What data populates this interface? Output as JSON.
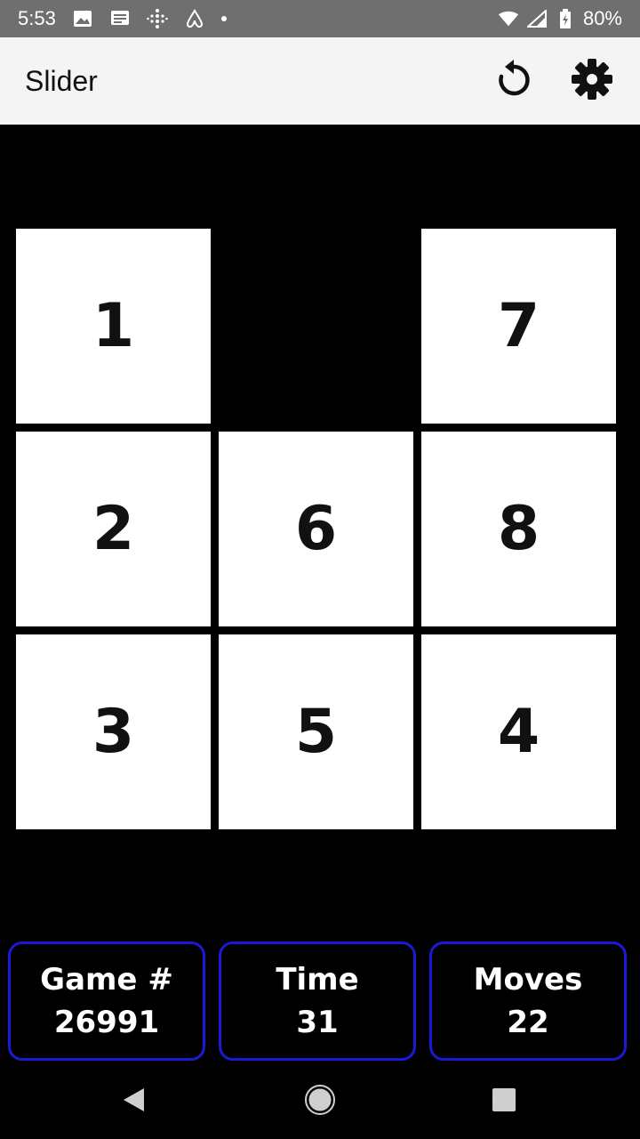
{
  "status_bar": {
    "time": "5:53",
    "battery": "80%",
    "icons": [
      "image-icon",
      "message-icon",
      "fitbit-icon",
      "airbnb-icon",
      "notification-dot",
      "wifi-icon",
      "signal-icon",
      "battery-icon"
    ]
  },
  "app_bar": {
    "title": "Slider",
    "actions": [
      "restart-icon",
      "gear-icon"
    ]
  },
  "board": {
    "rows": 3,
    "cols": 3,
    "empty": [
      0,
      1
    ],
    "tiles": [
      {
        "label": "1",
        "row": 0,
        "col": 0
      },
      {
        "label": "7",
        "row": 0,
        "col": 2
      },
      {
        "label": "2",
        "row": 1,
        "col": 0
      },
      {
        "label": "6",
        "row": 1,
        "col": 1
      },
      {
        "label": "8",
        "row": 1,
        "col": 2
      },
      {
        "label": "3",
        "row": 2,
        "col": 0
      },
      {
        "label": "5",
        "row": 2,
        "col": 1
      },
      {
        "label": "4",
        "row": 2,
        "col": 2
      }
    ]
  },
  "stats": {
    "game": {
      "label": "Game #",
      "value": "26991"
    },
    "time": {
      "label": "Time",
      "value": "31"
    },
    "moves": {
      "label": "Moves",
      "value": "22"
    }
  },
  "colors": {
    "stat_border": "#1a1ad6",
    "tile": "#ffffff",
    "background": "#000000"
  },
  "nav_bar": {
    "icons": [
      "back-icon",
      "home-icon",
      "recents-icon"
    ]
  }
}
